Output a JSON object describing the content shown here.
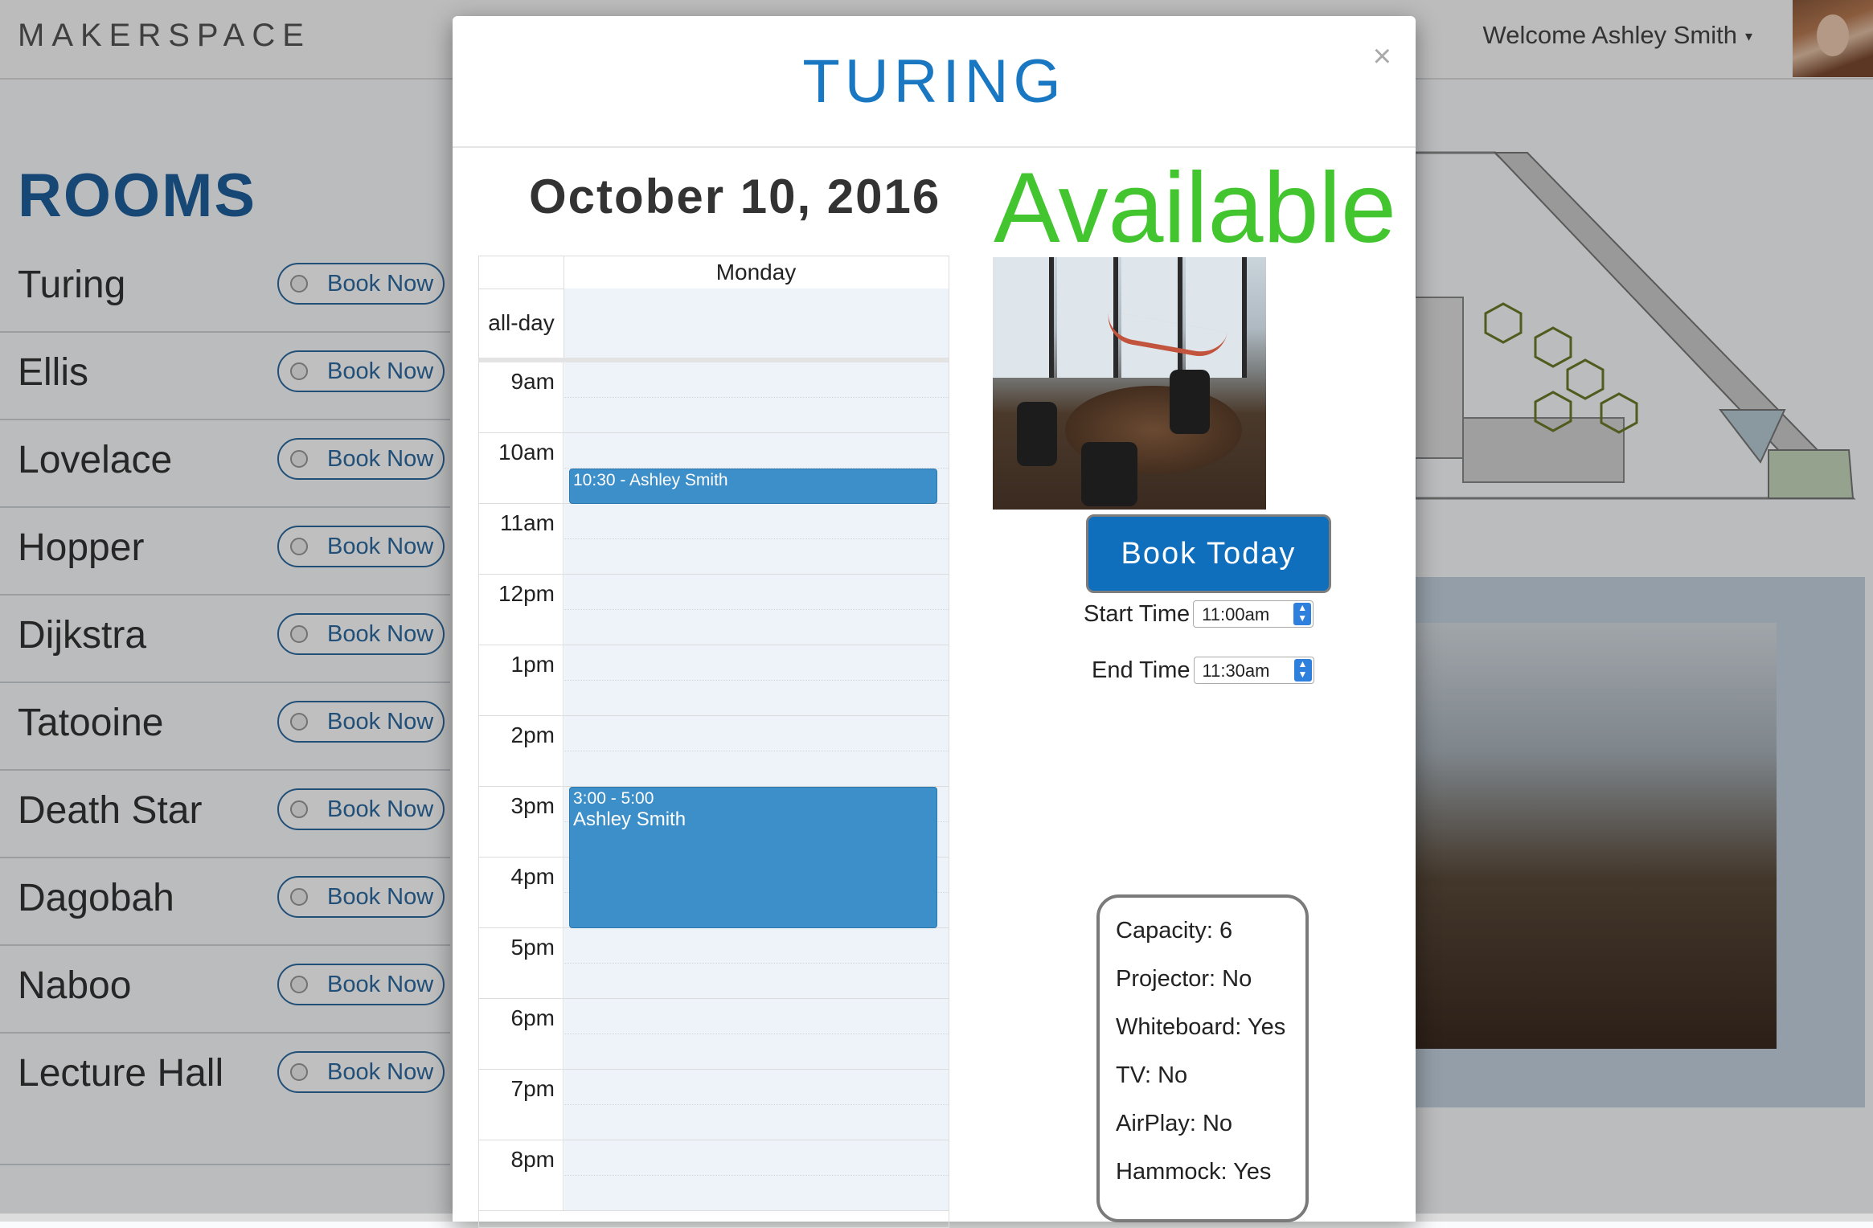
{
  "app": {
    "brand": "MAKERSPACE",
    "welcome": "Welcome Ashley Smith",
    "caret": "▾"
  },
  "rooms": {
    "title": "ROOMS",
    "book_label": "Book Now",
    "items": [
      {
        "name": "Turing"
      },
      {
        "name": "Ellis"
      },
      {
        "name": "Lovelace"
      },
      {
        "name": "Hopper"
      },
      {
        "name": "Dijkstra"
      },
      {
        "name": "Tatooine"
      },
      {
        "name": "Death Star"
      },
      {
        "name": "Dagobah"
      },
      {
        "name": "Naboo"
      },
      {
        "name": "Lecture Hall"
      }
    ]
  },
  "modal": {
    "title": "TURING",
    "close": "×",
    "date": "October 10, 2016",
    "status": "Available",
    "status_color": "#43c52f",
    "calendar": {
      "day": "Monday",
      "allday_label": "all-day",
      "hours": [
        "9am",
        "10am",
        "11am",
        "12pm",
        "1pm",
        "2pm",
        "3pm",
        "4pm",
        "5pm",
        "6pm",
        "7pm",
        "8pm"
      ],
      "events": [
        {
          "time": "10:30 - Ashley Smith",
          "name": ""
        },
        {
          "time": "3:00 - 5:00",
          "name": "Ashley Smith"
        }
      ]
    },
    "booking": {
      "start_label": "Start Time",
      "start_value": "11:00am",
      "end_label": "End Time",
      "end_value": "11:30am",
      "submit_label": "Book Today"
    },
    "amenities": [
      "Capacity: 6",
      "Projector: No",
      "Whiteboard: Yes",
      "TV: No",
      "AirPlay: No",
      "Hammock: Yes"
    ]
  }
}
